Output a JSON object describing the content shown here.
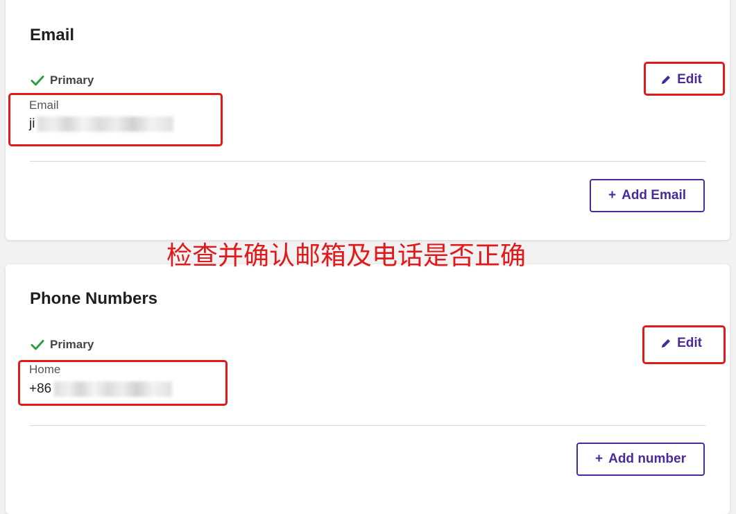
{
  "email_section": {
    "title": "Email",
    "primary_label": "Primary",
    "field_label": "Email",
    "value_visible": "ji",
    "edit_label": "Edit",
    "add_label": "Add Email",
    "add_prefix": "+"
  },
  "phone_section": {
    "title": "Phone Numbers",
    "primary_label": "Primary",
    "field_label": "Home",
    "value_visible": "+86",
    "edit_label": "Edit",
    "add_label": "Add number",
    "add_prefix": "+"
  },
  "annotation": {
    "text": "检查并确认邮箱及电话是否正确",
    "color": "#e0191b"
  },
  "icons": {
    "check": "check-icon",
    "pencil": "pencil-icon"
  },
  "colors": {
    "accent": "#4a2a9a",
    "check_green": "#2e9e3e",
    "annotation_red": "#e0191b"
  }
}
